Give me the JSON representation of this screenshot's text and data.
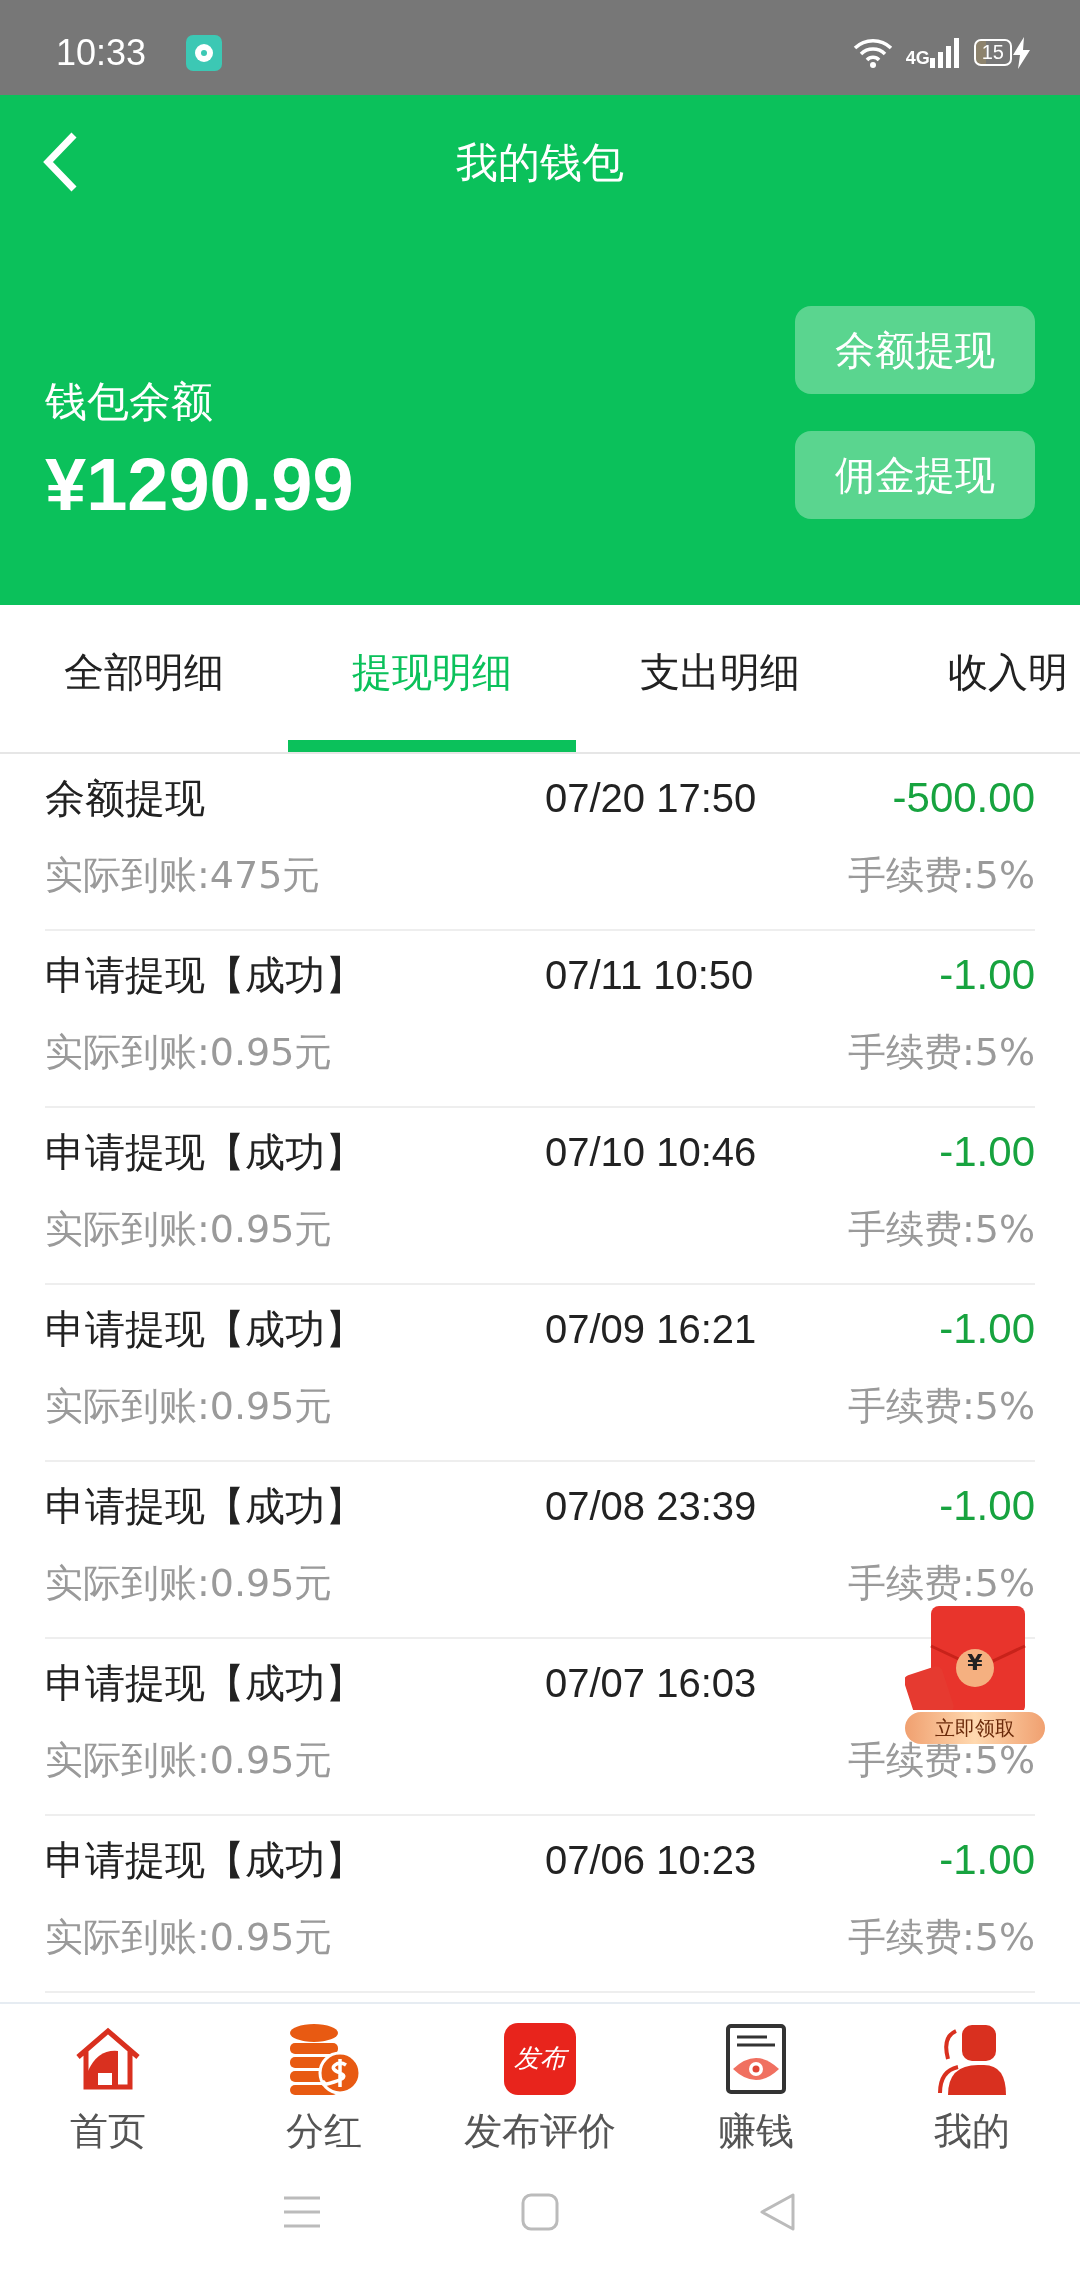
{
  "status_bar": {
    "time": "10:33",
    "network": "4G",
    "battery": "15"
  },
  "header": {
    "title": "我的钱包",
    "balance_label": "钱包余额",
    "balance": "¥1290.99",
    "buttons": [
      "余额提现",
      "佣金提现"
    ]
  },
  "tabs": [
    {
      "label": "全部明细",
      "selected": false
    },
    {
      "label": "提现明细",
      "selected": true
    },
    {
      "label": "支出明细",
      "selected": false
    },
    {
      "label": "收入明",
      "selected": false
    }
  ],
  "records": [
    {
      "title": "余额提现",
      "time": "07/20 17:50",
      "amount": "-500.00",
      "received": "实际到账:475元",
      "fee": "手续费:5%"
    },
    {
      "title": "申请提现【成功】",
      "time": "07/11 10:50",
      "amount": "-1.00",
      "received": "实际到账:0.95元",
      "fee": "手续费:5%"
    },
    {
      "title": "申请提现【成功】",
      "time": "07/10 10:46",
      "amount": "-1.00",
      "received": "实际到账:0.95元",
      "fee": "手续费:5%"
    },
    {
      "title": "申请提现【成功】",
      "time": "07/09 16:21",
      "amount": "-1.00",
      "received": "实际到账:0.95元",
      "fee": "手续费:5%"
    },
    {
      "title": "申请提现【成功】",
      "time": "07/08 23:39",
      "amount": "-1.00",
      "received": "实际到账:0.95元",
      "fee": "手续费:5%"
    },
    {
      "title": "申请提现【成功】",
      "time": "07/07 16:03",
      "received": "实际到账:0.95元",
      "fee": "手续费:5%"
    },
    {
      "title": "申请提现【成功】",
      "time": "07/06 10:23",
      "amount": "-1.00",
      "received": "实际到账:0.95元",
      "fee": "手续费:5%"
    }
  ],
  "promo": {
    "symbol": "¥",
    "label": "立即领取"
  },
  "bottom_nav": [
    {
      "kind": "home",
      "label": "首页"
    },
    {
      "kind": "coins",
      "label": "分红"
    },
    {
      "kind": "publish",
      "label": "发布评价",
      "icon_text": "发布"
    },
    {
      "kind": "eye",
      "label": "赚钱"
    },
    {
      "kind": "user",
      "label": "我的"
    }
  ]
}
